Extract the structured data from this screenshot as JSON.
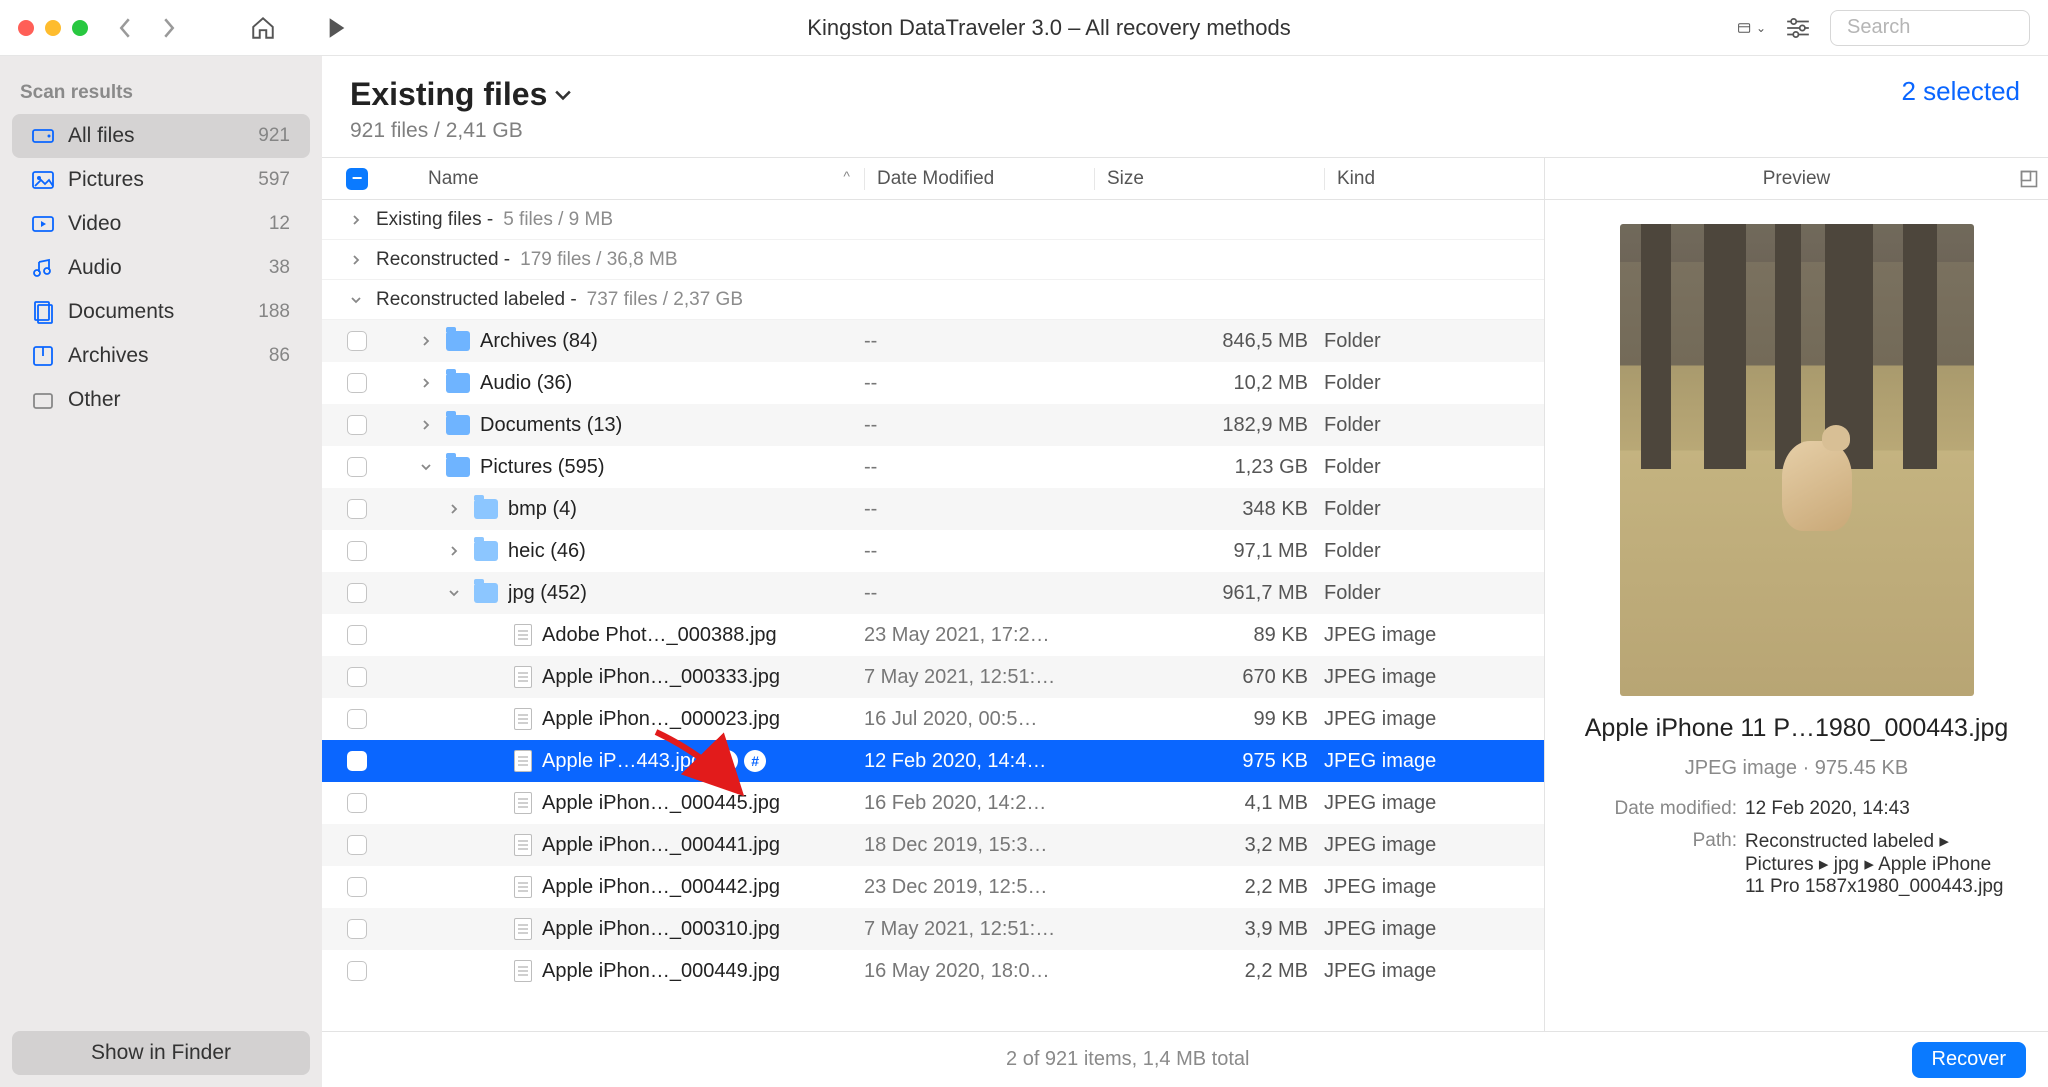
{
  "toolbar": {
    "title": "Kingston DataTraveler 3.0 – All recovery methods",
    "search_placeholder": "Search"
  },
  "sidebar": {
    "title": "Scan results",
    "items": [
      {
        "label": "All files",
        "count": "921",
        "selected": true,
        "icon": "disk"
      },
      {
        "label": "Pictures",
        "count": "597",
        "icon": "picture"
      },
      {
        "label": "Video",
        "count": "12",
        "icon": "video"
      },
      {
        "label": "Audio",
        "count": "38",
        "icon": "audio"
      },
      {
        "label": "Documents",
        "count": "188",
        "icon": "document"
      },
      {
        "label": "Archives",
        "count": "86",
        "icon": "archive"
      },
      {
        "label": "Other",
        "count": "",
        "icon": "other"
      }
    ],
    "show_finder": "Show in Finder"
  },
  "header": {
    "title": "Existing files",
    "sub": "921 files / 2,41 GB",
    "selected": "2 selected"
  },
  "columns": {
    "name": "Name",
    "date": "Date Modified",
    "size": "Size",
    "kind": "Kind"
  },
  "groups": [
    {
      "expanded": false,
      "name": "Existing files",
      "meta": "5 files / 9 MB"
    },
    {
      "expanded": false,
      "name": "Reconstructed",
      "meta": "179 files / 36,8 MB"
    },
    {
      "expanded": true,
      "name": "Reconstructed labeled",
      "meta": "737 files / 2,37 GB"
    }
  ],
  "rows": [
    {
      "indent": 1,
      "type": "folder",
      "disclosure": "right",
      "name": "Archives (84)",
      "date": "--",
      "size": "846,5 MB",
      "kind": "Folder"
    },
    {
      "indent": 1,
      "type": "folder",
      "disclosure": "right",
      "name": "Audio (36)",
      "date": "--",
      "size": "10,2 MB",
      "kind": "Folder"
    },
    {
      "indent": 1,
      "type": "folder",
      "disclosure": "right",
      "name": "Documents (13)",
      "date": "--",
      "size": "182,9 MB",
      "kind": "Folder"
    },
    {
      "indent": 1,
      "type": "folder",
      "disclosure": "down",
      "name": "Pictures (595)",
      "date": "--",
      "size": "1,23 GB",
      "kind": "Folder"
    },
    {
      "indent": 2,
      "type": "folder",
      "disclosure": "right",
      "light": true,
      "name": "bmp (4)",
      "date": "--",
      "size": "348 KB",
      "kind": "Folder"
    },
    {
      "indent": 2,
      "type": "folder",
      "disclosure": "right",
      "light": true,
      "name": "heic (46)",
      "date": "--",
      "size": "97,1 MB",
      "kind": "Folder"
    },
    {
      "indent": 2,
      "type": "folder",
      "disclosure": "down",
      "light": true,
      "name": "jpg (452)",
      "date": "--",
      "size": "961,7 MB",
      "kind": "Folder"
    },
    {
      "indent": 3,
      "type": "file",
      "name": "Adobe Phot…_000388.jpg",
      "date": "23 May 2021, 17:2…",
      "size": "89 KB",
      "kind": "JPEG image"
    },
    {
      "indent": 3,
      "type": "file",
      "name": "Apple iPhon…_000333.jpg",
      "date": "7 May 2021, 12:51:…",
      "size": "670 KB",
      "kind": "JPEG image"
    },
    {
      "indent": 3,
      "type": "file",
      "name": "Apple iPhon…_000023.jpg",
      "date": "16 Jul 2020, 00:5…",
      "size": "99 KB",
      "kind": "JPEG image"
    },
    {
      "indent": 3,
      "type": "file",
      "selected": true,
      "badges": true,
      "name": "Apple iP…443.jpg",
      "date": "12 Feb 2020, 14:4…",
      "size": "975 KB",
      "kind": "JPEG image"
    },
    {
      "indent": 3,
      "type": "file",
      "name": "Apple iPhon…_000445.jpg",
      "date": "16 Feb 2020, 14:2…",
      "size": "4,1 MB",
      "kind": "JPEG image"
    },
    {
      "indent": 3,
      "type": "file",
      "name": "Apple iPhon…_000441.jpg",
      "date": "18 Dec 2019, 15:3…",
      "size": "3,2 MB",
      "kind": "JPEG image"
    },
    {
      "indent": 3,
      "type": "file",
      "name": "Apple iPhon…_000442.jpg",
      "date": "23 Dec 2019, 12:5…",
      "size": "2,2 MB",
      "kind": "JPEG image"
    },
    {
      "indent": 3,
      "type": "file",
      "name": "Apple iPhon…_000310.jpg",
      "date": "7 May 2021, 12:51:…",
      "size": "3,9 MB",
      "kind": "JPEG image"
    },
    {
      "indent": 3,
      "type": "file",
      "name": "Apple iPhon…_000449.jpg",
      "date": "16 May 2020, 18:0…",
      "size": "2,2 MB",
      "kind": "JPEG image"
    }
  ],
  "preview": {
    "header": "Preview",
    "name": "Apple iPhone 11 P…1980_000443.jpg",
    "meta": "JPEG image · 975.45 KB",
    "date_label": "Date modified:",
    "date": "12 Feb 2020, 14:43",
    "path_label": "Path:",
    "path": "Reconstructed labeled ▸ Pictures ▸ jpg ▸ Apple iPhone 11 Pro 1587x1980_000443.jpg"
  },
  "footer": {
    "status": "2 of 921 items, 1,4 MB total",
    "recover": "Recover"
  }
}
